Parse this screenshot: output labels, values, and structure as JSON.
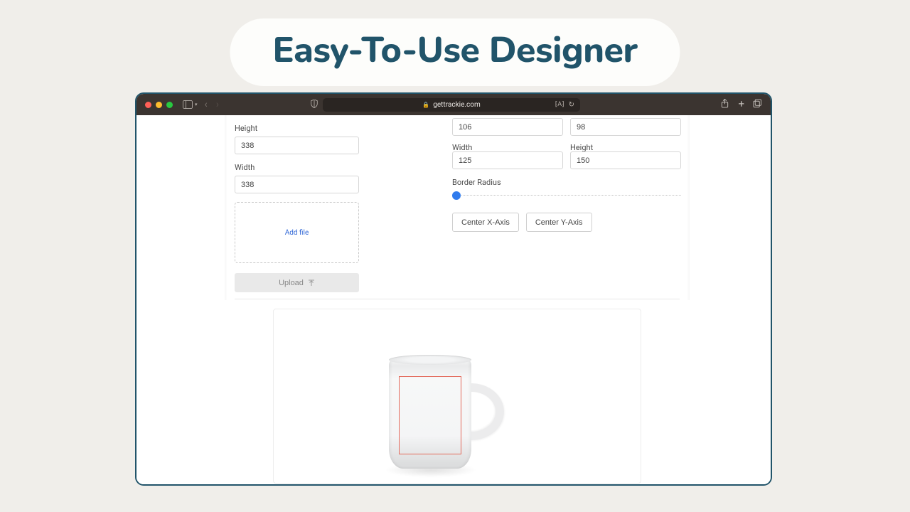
{
  "page": {
    "heading": "Easy-To-Use Designer"
  },
  "browser": {
    "url": "gettrackie.com"
  },
  "leftPanel": {
    "heightLabel": "Height",
    "heightValue": "338",
    "widthLabel": "Width",
    "widthValue": "338",
    "addFile": "Add file",
    "uploadLabel": "Upload"
  },
  "rightPanel": {
    "xValue": "106",
    "yValue": "98",
    "widthLabel": "Width",
    "widthValue": "125",
    "heightLabel": "Height",
    "heightValue": "150",
    "borderRadiusLabel": "Border Radius",
    "borderRadiusValue": 0,
    "centerXLabel": "Center X-Axis",
    "centerYLabel": "Center Y-Axis"
  }
}
